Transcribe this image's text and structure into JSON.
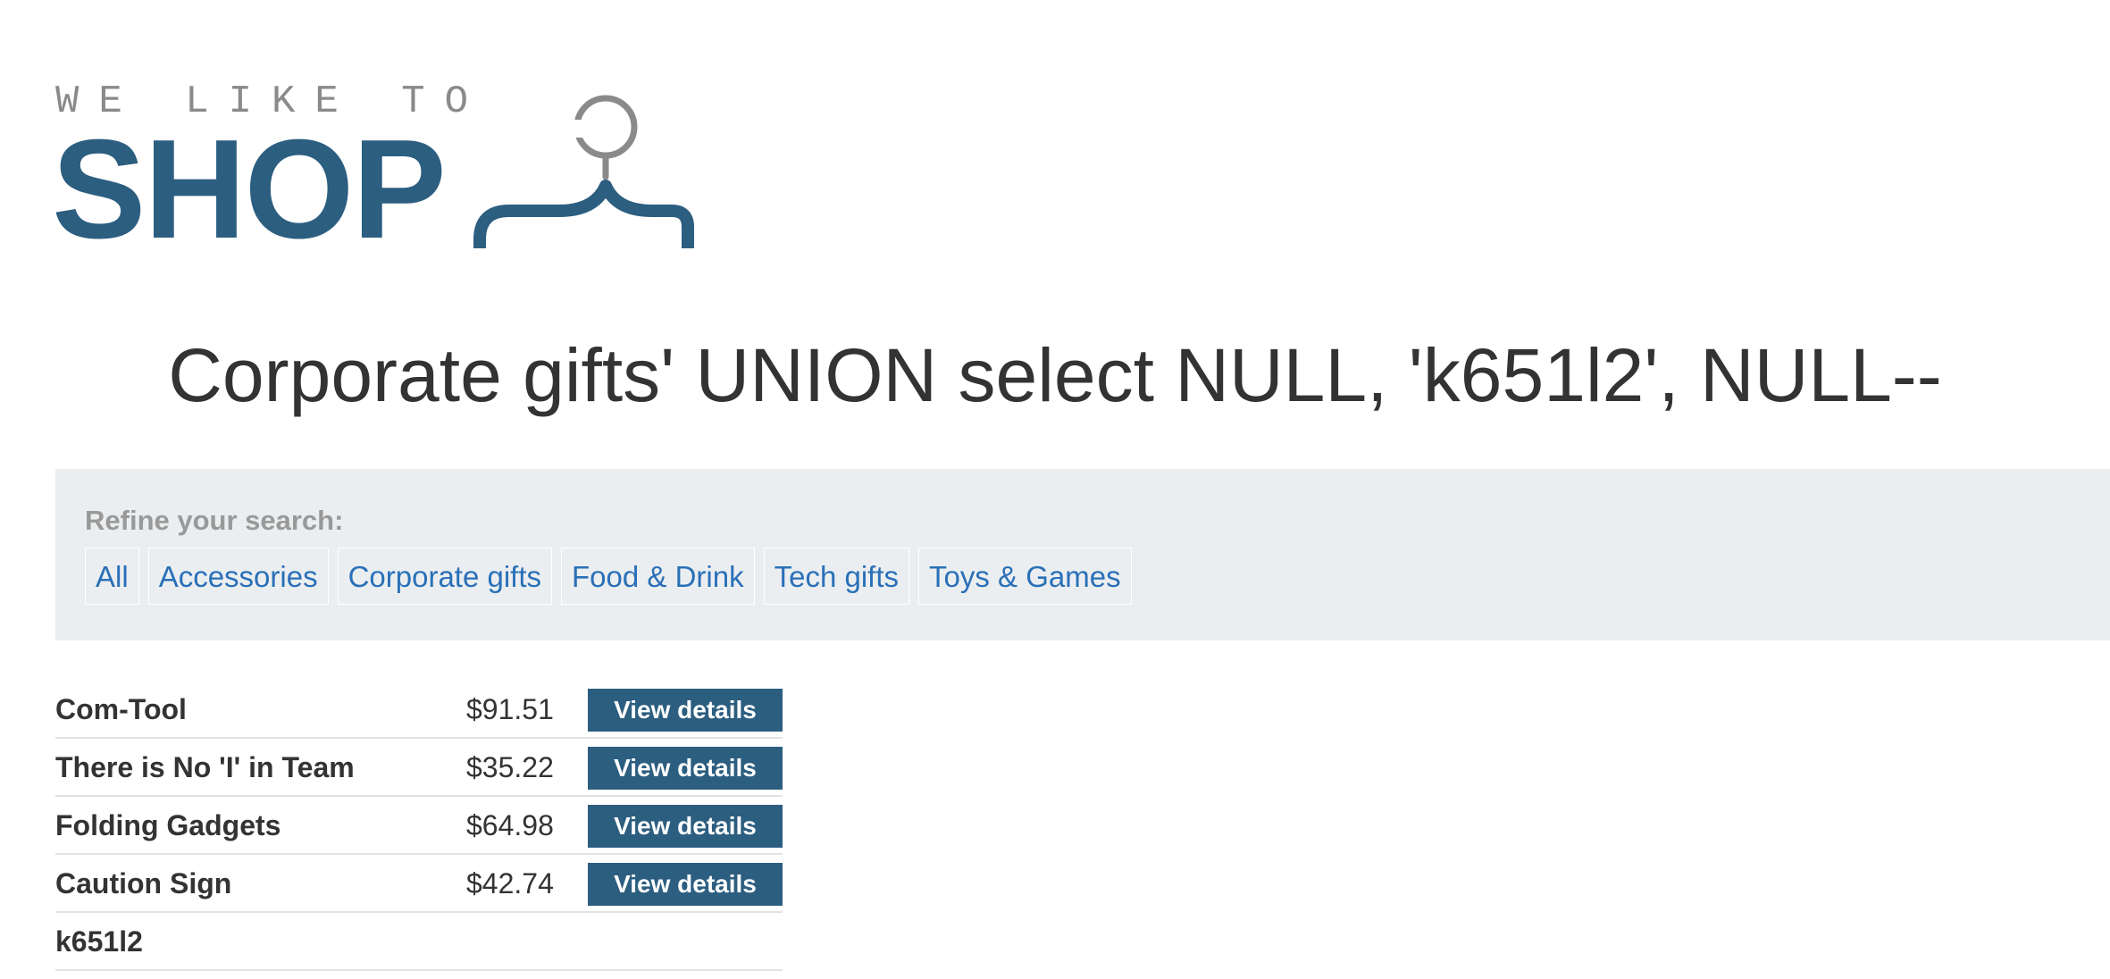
{
  "logo": {
    "tagline": "WE LIKE TO",
    "wordmark": "SHOP",
    "icon": "coat-hanger-icon",
    "colors": {
      "wordmark": "#2c5e80",
      "tagline": "#8a8a8a",
      "hook": "#8a8a8a"
    }
  },
  "heading": "Corporate gifts' UNION select NULL, 'k651l2', NULL--",
  "filters": {
    "label": "Refine your search:",
    "items": [
      {
        "label": "All"
      },
      {
        "label": "Accessories"
      },
      {
        "label": "Corporate gifts"
      },
      {
        "label": "Food & Drink"
      },
      {
        "label": "Tech gifts"
      },
      {
        "label": "Toys & Games"
      }
    ]
  },
  "products": [
    {
      "name": "Com-Tool",
      "price": "$91.51",
      "action": "View details"
    },
    {
      "name": "There is No 'I' in Team",
      "price": "$35.22",
      "action": "View details"
    },
    {
      "name": "Folding Gadgets",
      "price": "$64.98",
      "action": "View details"
    },
    {
      "name": "Caution Sign",
      "price": "$42.74",
      "action": "View details"
    },
    {
      "name": "k651l2",
      "price": "",
      "action": ""
    }
  ],
  "colors": {
    "accent": "#2c5e80",
    "link": "#2a70b8",
    "panel_background": "#ebeef0",
    "text": "#333333"
  }
}
